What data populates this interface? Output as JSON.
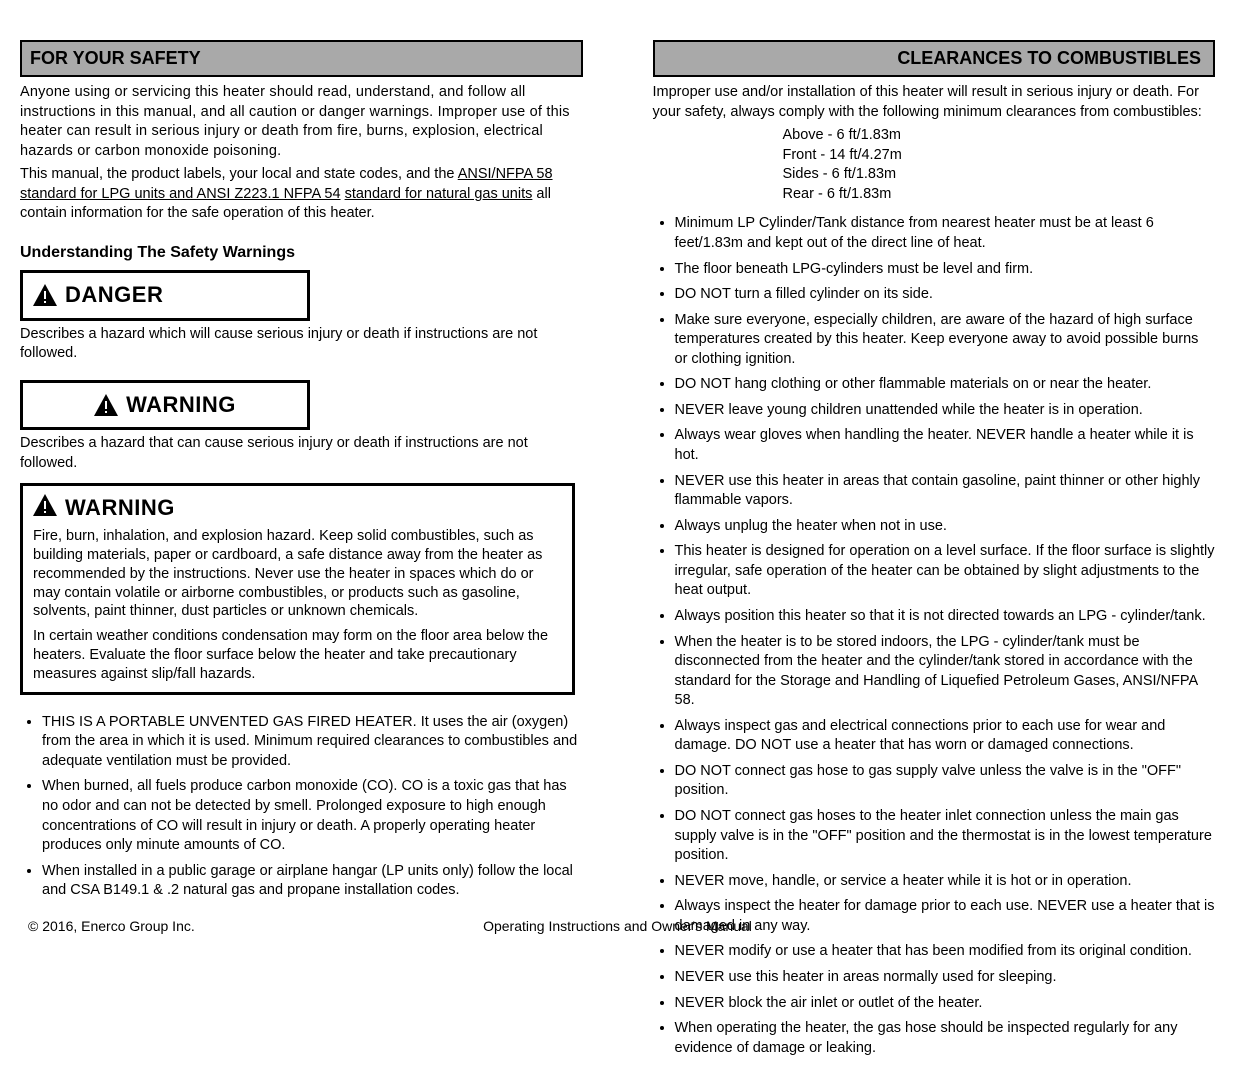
{
  "left": {
    "header": "FOR YOUR SAFETY",
    "intro": "Anyone using or servicing this heater should read, understand, and follow all instructions in this manual, and all caution or danger warnings. Improper use of this heater can result in serious injury or death from fire, burns, explosion, electrical hazards or carbon monoxide poisoning.",
    "link_intro": "This manual, the product labels, your local and state codes, and the",
    "link1_text": "ANSI/NFPA 58 standard for LPG units and ANSI Z223.1 NFPA 54",
    "link2_text": "standard for natural gas units",
    "post_link": " all contain information for the safe operation of this heater.",
    "sub": "Understanding The Safety Warnings",
    "danger_label": "DANGER",
    "danger_desc": "Describes a hazard which will cause serious injury or death if instructions are not followed.",
    "warning_label": "WARNING",
    "warning_desc": "Describes a hazard that can cause serious injury or death if instructions are not followed.",
    "w2_label": "WARNING",
    "w2_line1": "Fire, burn, inhalation, and explosion hazard. Keep solid combustibles, such as building materials, paper or cardboard, a safe distance away from the heater as recommended by the instructions. Never use the heater in spaces which do or may contain volatile or airborne combustibles, or products such as gasoline, solvents, paint thinner, dust particles or unknown chemicals.",
    "w2_line2": "In certain weather conditions condensation may form on the floor area below the heaters. Evaluate the floor surface below the heater and take precautionary measures against slip/fall hazards.",
    "bullets": [
      "THIS IS A PORTABLE UNVENTED GAS FIRED HEATER. It uses the air (oxygen) from the area in which it is used. Minimum required clearances to combustibles and adequate ventilation must be provided.",
      "When burned, all fuels produce carbon monoxide (CO). CO is a toxic gas that has no odor and can not be detected by smell. Prolonged exposure to high enough concentrations of CO will result in injury or death. A properly operating heater produces only minute amounts of CO.",
      "When installed in a public garage or airplane hangar (LP units only) follow the local and CSA B149.1 & .2 natural gas and propane installation codes."
    ]
  },
  "right": {
    "header": "CLEARANCES TO COMBUSTIBLES",
    "intro": "Improper use and/or installation of this heater will result in serious injury or death. For your safety, always comply with the following minimum clearances from combustibles:",
    "clearances": [
      "Above - 6 ft/1.83m",
      "Front - 14 ft/4.27m",
      "Sides - 6 ft/1.83m",
      "Rear - 6 ft/1.83m"
    ],
    "bullets": [
      "Minimum LP Cylinder/Tank distance from nearest heater must be at least 6 feet/1.83m and kept out of the direct line of heat.",
      "The floor beneath LPG-cylinders must be level and firm.",
      "DO NOT turn a filled cylinder on its side.",
      "Make sure everyone, especially children, are aware of the hazard of high surface temperatures created by this heater. Keep everyone away to avoid possible burns or clothing ignition.",
      "DO NOT hang clothing or other flammable materials on or near the heater.",
      "NEVER leave young children unattended while the heater is in operation.",
      "Always wear gloves when handling the heater. NEVER handle a heater while it is hot.",
      "NEVER use this heater in areas that contain gasoline, paint thinner or other highly flammable vapors.",
      "Always unplug the heater when not in use.",
      "This heater is designed for operation on a level surface. If the floor surface is slightly irregular, safe operation of the heater can be obtained by slight adjustments to the heat output.",
      "Always position this heater so that it is not directed towards an LPG - cylinder/tank.",
      "When the heater is to be stored indoors, the LPG - cylinder/tank must be disconnected from the heater and the cylinder/tank stored in accordance with the standard for the Storage and Handling of Liquefied Petroleum Gases, ANSI/NFPA 58.",
      "Always inspect gas and electrical connections prior to each use for wear and damage. DO NOT use a heater that has worn or damaged connections.",
      "DO NOT connect gas hose to gas supply valve unless the valve is in the \"OFF\" position.",
      "DO NOT connect gas hoses to the heater inlet connection unless the main gas supply valve is in the \"OFF\" position and the thermostat is in the lowest temperature position.",
      "NEVER move, handle, or service a heater while it is hot or in operation.",
      "Always inspect the heater for damage prior to each use. NEVER use a heater that is damaged in any way.",
      "NEVER modify or use a heater that has been modified from its original condition.",
      "NEVER use this heater in areas normally used for sleeping.",
      "NEVER block the air inlet or outlet of the heater.",
      "When operating the heater, the gas hose should be inspected regularly for any evidence of damage or leaking."
    ]
  },
  "footer": {
    "left": "© 2016, Enerco Group Inc.",
    "center": "Operating Instructions and Owner's Manual"
  }
}
